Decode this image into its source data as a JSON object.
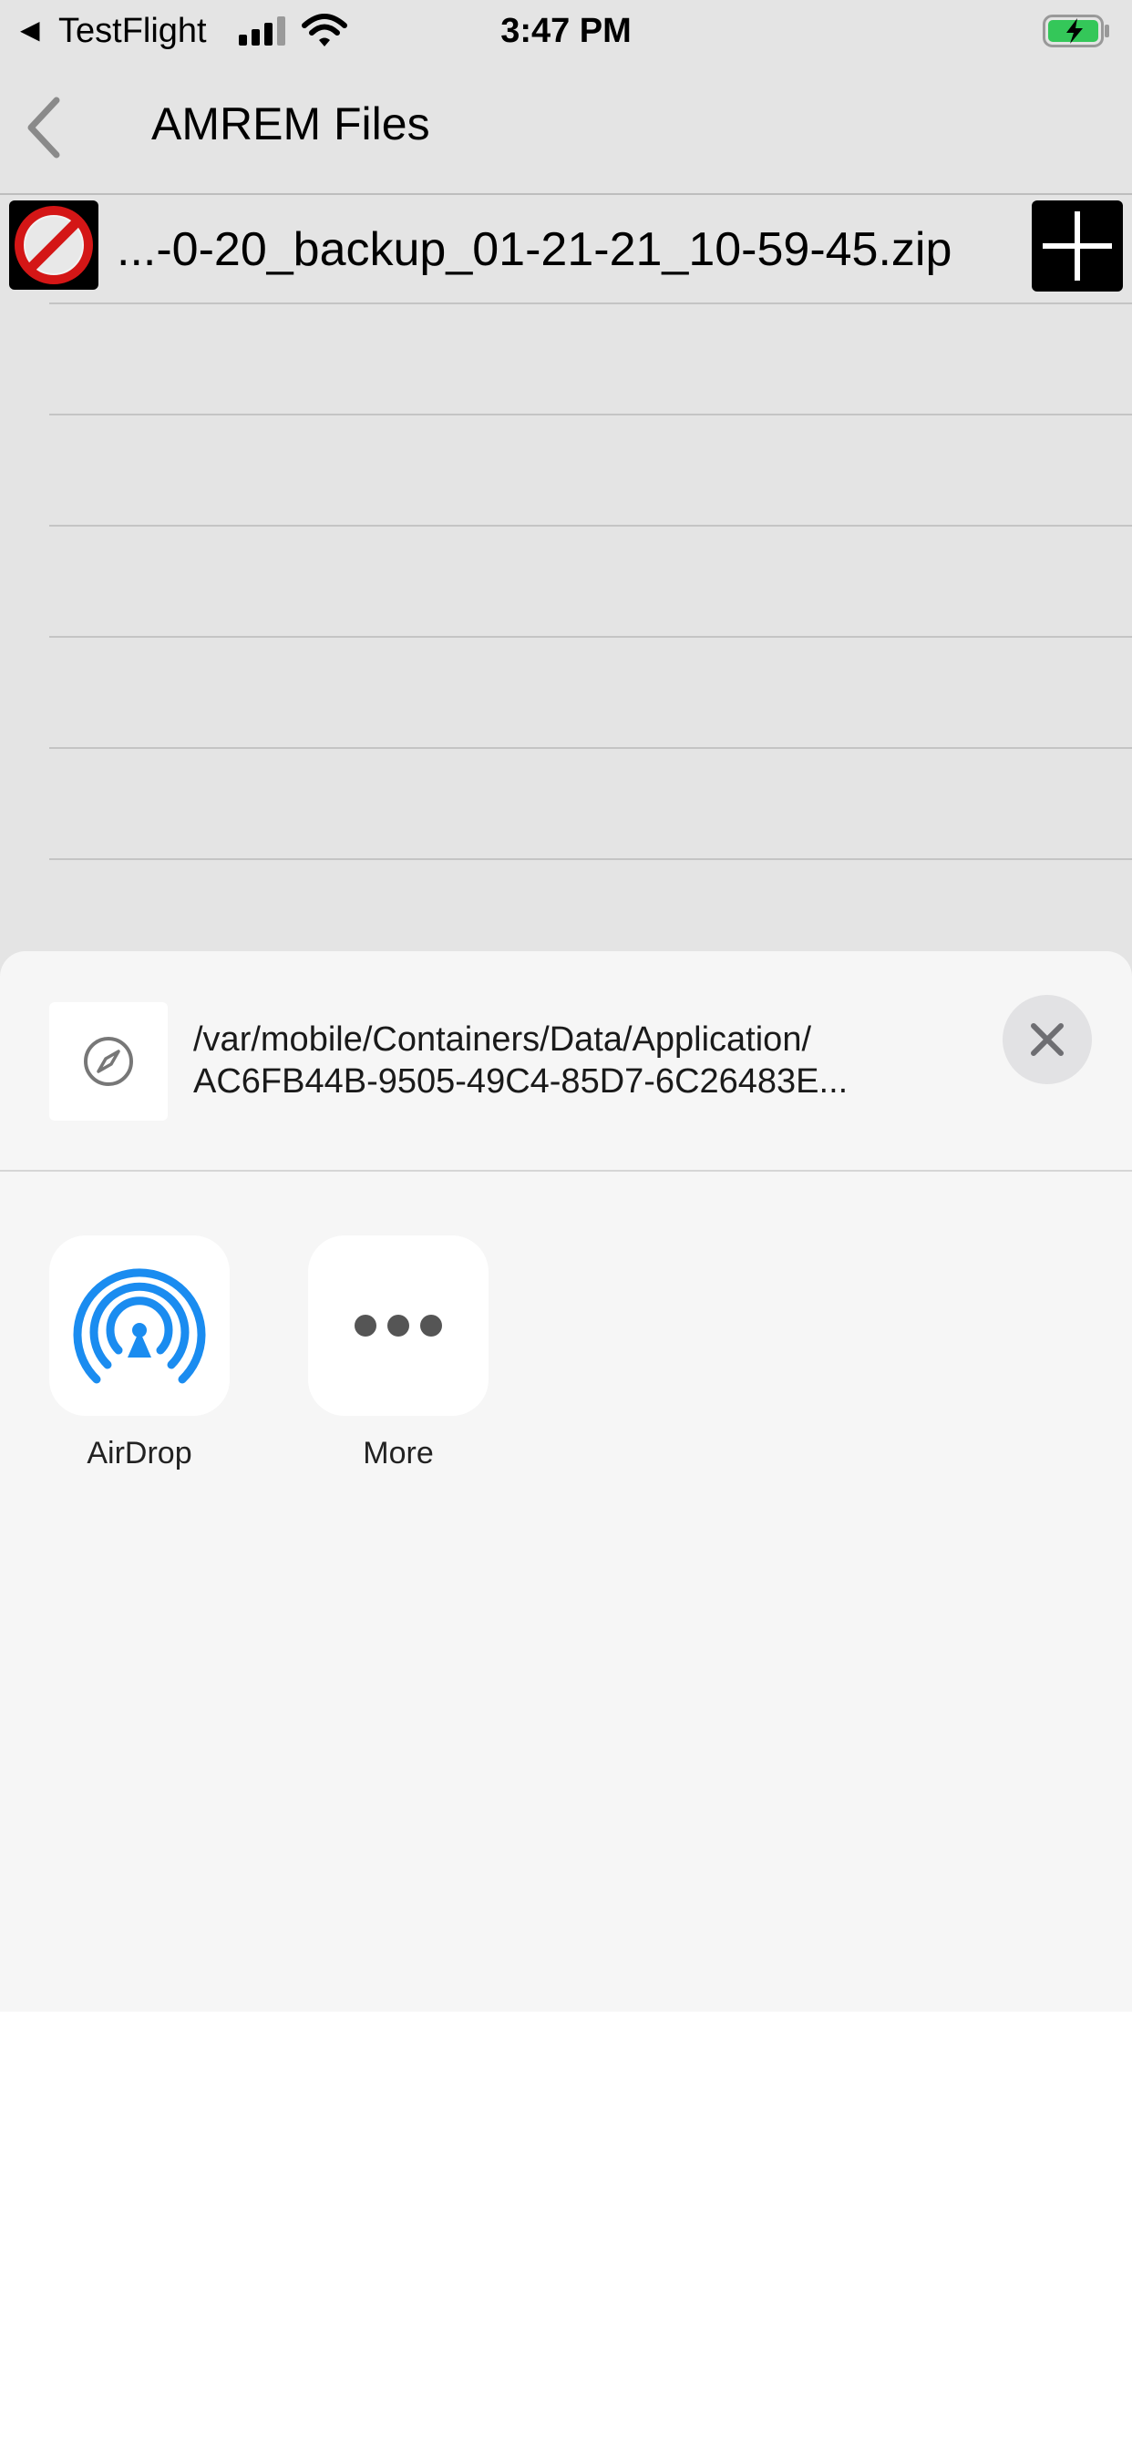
{
  "status_bar": {
    "back_glyph": "◀",
    "back_app": "TestFlight",
    "time": "3:47 PM",
    "signal_icon": "cellular-signal-icon",
    "wifi_icon": "wifi-icon",
    "battery_icon": "battery-charging-icon",
    "battery_color": "#34c759"
  },
  "nav": {
    "title": "AMREM Files",
    "back_icon": "chevron-left-icon"
  },
  "files": [
    {
      "name": "...-0-20_backup_01-21-21_10-59-45.zip",
      "left_icon": "no-sign-icon",
      "right_icon": "plus-icon"
    }
  ],
  "share_sheet": {
    "path_line_1": "/var/mobile/Containers/Data/Application/",
    "path_line_2": "AC6FB44B-9505-49C4-85D7-6C26483E...",
    "preview_icon": "compass-icon",
    "close_icon": "close-icon",
    "actions": [
      {
        "label": "AirDrop",
        "icon": "airdrop-icon",
        "color": "#1a8cf0"
      },
      {
        "label": "More",
        "icon": "more-icon",
        "color": "#555555"
      }
    ]
  },
  "colors": {
    "dim_background": "#e4e4e4",
    "sheet_background": "#f6f6f6",
    "airdrop_blue": "#1a8cf0"
  }
}
